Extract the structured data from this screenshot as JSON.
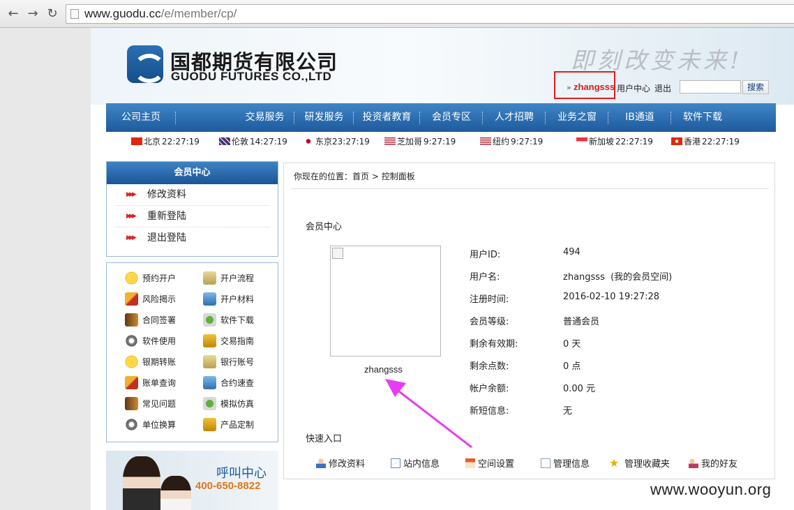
{
  "browser": {
    "url_host": "www.guodu.cc",
    "url_path": "/e/member/cp/"
  },
  "header": {
    "logo_cn": "国都期货有限公司",
    "logo_en": "GUODU FUTURES CO.,LTD",
    "slogan": "即刻改变未来!",
    "username_prefix": "»",
    "username": "zhangsss",
    "user_center": "用户中心",
    "logout": "退出",
    "search_value": "",
    "search_button": "搜索"
  },
  "nav": [
    "公司主页",
    "交易服务",
    "研发服务",
    "投资者教育",
    "会员专区",
    "人才招聘",
    "业务之窗",
    "IB通道",
    "软件下载"
  ],
  "clocks": [
    {
      "city": "北京",
      "time": "22:27:19"
    },
    {
      "city": "伦敦",
      "time": "14:27:19"
    },
    {
      "city": "东京",
      "time": "23:27:19"
    },
    {
      "city": "芝加哥",
      "time": "9:27:19"
    },
    {
      "city": "纽约",
      "time": "9:27:19"
    },
    {
      "city": "新加坡",
      "time": "22:27:19"
    },
    {
      "city": "香港",
      "time": "22:27:19"
    }
  ],
  "sidebar": {
    "title": "会员中心",
    "items": [
      "修改资料",
      "重新登陆",
      "退出登陆"
    ]
  },
  "grid_links": [
    "预约开户",
    "开户流程",
    "风险揭示",
    "开户材料",
    "合同签署",
    "软件下载",
    "软件使用",
    "交易指南",
    "银期转账",
    "银行账号",
    "账单查询",
    "合约速查",
    "常见问题",
    "模拟仿真",
    "单位换算",
    "产品定制"
  ],
  "call_center": {
    "title": "呼叫中心",
    "phone": "400-650-8822"
  },
  "content": {
    "breadcrumb_prefix": "你现在的位置：",
    "breadcrumb_home": "首页",
    "breadcrumb_sep": ">",
    "breadcrumb_current": "控制面板",
    "section_title": "会员中心",
    "avatar_name": "zhangsss",
    "info": [
      {
        "label": "用户ID:",
        "value": "494"
      },
      {
        "label": "用户名:",
        "value": "zhangsss",
        "extra": "(我的会员空间)"
      },
      {
        "label": "注册时间:",
        "value": "2016-02-10 19:27:28"
      },
      {
        "label": "会员等级:",
        "value": "普通会员"
      },
      {
        "label": "剩余有效期:",
        "value": "0 天"
      },
      {
        "label": "剩余点数:",
        "value": "0 点"
      },
      {
        "label": "帐户余额:",
        "value": "0.00 元"
      },
      {
        "label": "新短信息:",
        "value": "无"
      }
    ],
    "quick_title": "快速入口",
    "quick_links": [
      "修改资料",
      "站内信息",
      "空间设置",
      "管理信息",
      "管理收藏夹",
      "我的好友"
    ]
  },
  "watermark": "www.wooyun.org",
  "colors": {
    "nav_blue": "#1d5a9c",
    "highlight_red": "#e21b1b",
    "arrow_magenta": "#e83cf0",
    "call_orange": "#e07818"
  }
}
